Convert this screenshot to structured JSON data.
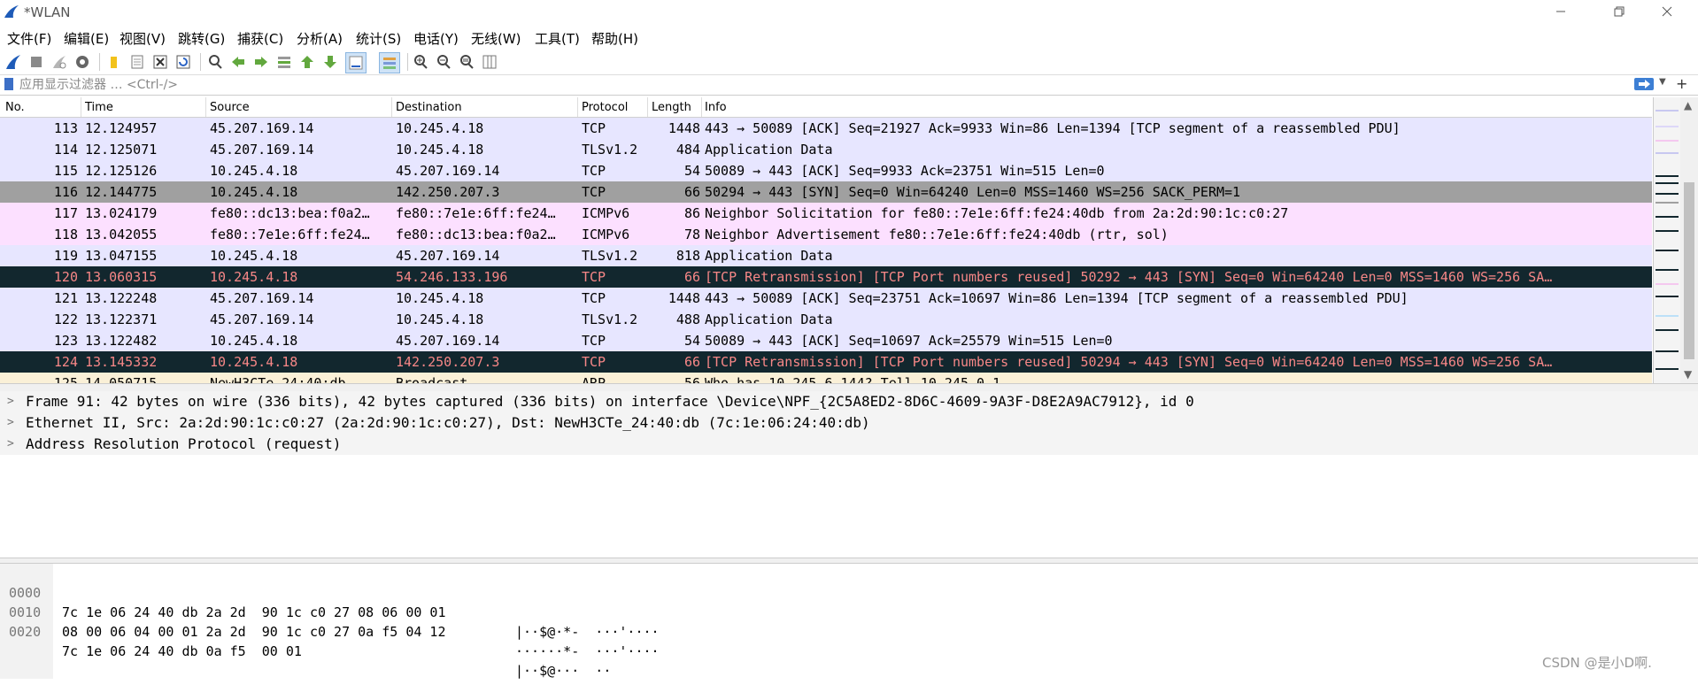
{
  "window": {
    "title": "*WLAN"
  },
  "menu": [
    "文件(F)",
    "编辑(E)",
    "视图(V)",
    "跳转(G)",
    "捕获(C)",
    "分析(A)",
    "统计(S)",
    "电话(Y)",
    "无线(W)",
    "工具(T)",
    "帮助(H)"
  ],
  "filter": {
    "placeholder": "应用显示过滤器 … <Ctrl-/>"
  },
  "columns": [
    "No.",
    "Time",
    "Source",
    "Destination",
    "Protocol",
    "Length",
    "Info"
  ],
  "colors": {
    "tcp_bg": "#e7e6ff",
    "selected_bg": "#a0a0a0",
    "icmp_bg": "#fce0ff",
    "bad_bg": "#12272e",
    "bad_fg": "#f78787",
    "arp_bg": "#faf0d7"
  },
  "packets": [
    {
      "no": "113",
      "time": "12.124957",
      "src": "45.207.169.14",
      "dst": "10.245.4.18",
      "proto": "TCP",
      "len": "1448",
      "info": "443 → 50089 [ACK] Seq=21927 Ack=9933 Win=86 Len=1394 [TCP segment of a reassembled PDU]",
      "style": "tcp"
    },
    {
      "no": "114",
      "time": "12.125071",
      "src": "45.207.169.14",
      "dst": "10.245.4.18",
      "proto": "TLSv1.2",
      "len": "484",
      "info": "Application Data",
      "style": "tcp"
    },
    {
      "no": "115",
      "time": "12.125126",
      "src": "10.245.4.18",
      "dst": "45.207.169.14",
      "proto": "TCP",
      "len": "54",
      "info": "50089 → 443 [ACK] Seq=9933 Ack=23751 Win=515 Len=0",
      "style": "tcp"
    },
    {
      "no": "116",
      "time": "12.144775",
      "src": "10.245.4.18",
      "dst": "142.250.207.3",
      "proto": "TCP",
      "len": "66",
      "info": "50294 → 443 [SYN] Seq=0 Win=64240 Len=0 MSS=1460 WS=256 SACK_PERM=1",
      "style": "selected"
    },
    {
      "no": "117",
      "time": "13.024179",
      "src": "fe80::dc13:bea:f0a2…",
      "dst": "fe80::7e1e:6ff:fe24…",
      "proto": "ICMPv6",
      "len": "86",
      "info": "Neighbor Solicitation for fe80::7e1e:6ff:fe24:40db from 2a:2d:90:1c:c0:27",
      "style": "icmp"
    },
    {
      "no": "118",
      "time": "13.042055",
      "src": "fe80::7e1e:6ff:fe24…",
      "dst": "fe80::dc13:bea:f0a2…",
      "proto": "ICMPv6",
      "len": "78",
      "info": "Neighbor Advertisement fe80::7e1e:6ff:fe24:40db (rtr, sol)",
      "style": "icmp"
    },
    {
      "no": "119",
      "time": "13.047155",
      "src": "10.245.4.18",
      "dst": "45.207.169.14",
      "proto": "TLSv1.2",
      "len": "818",
      "info": "Application Data",
      "style": "tcp"
    },
    {
      "no": "120",
      "time": "13.060315",
      "src": "10.245.4.18",
      "dst": "54.246.133.196",
      "proto": "TCP",
      "len": "66",
      "info": "[TCP Retransmission] [TCP Port numbers reused] 50292 → 443 [SYN] Seq=0 Win=64240 Len=0 MSS=1460 WS=256 SA…",
      "style": "bad"
    },
    {
      "no": "121",
      "time": "13.122248",
      "src": "45.207.169.14",
      "dst": "10.245.4.18",
      "proto": "TCP",
      "len": "1448",
      "info": "443 → 50089 [ACK] Seq=23751 Ack=10697 Win=86 Len=1394 [TCP segment of a reassembled PDU]",
      "style": "tcp"
    },
    {
      "no": "122",
      "time": "13.122371",
      "src": "45.207.169.14",
      "dst": "10.245.4.18",
      "proto": "TLSv1.2",
      "len": "488",
      "info": "Application Data",
      "style": "tcp"
    },
    {
      "no": "123",
      "time": "13.122482",
      "src": "10.245.4.18",
      "dst": "45.207.169.14",
      "proto": "TCP",
      "len": "54",
      "info": "50089 → 443 [ACK] Seq=10697 Ack=25579 Win=515 Len=0",
      "style": "tcp"
    },
    {
      "no": "124",
      "time": "13.145332",
      "src": "10.245.4.18",
      "dst": "142.250.207.3",
      "proto": "TCP",
      "len": "66",
      "info": "[TCP Retransmission] [TCP Port numbers reused] 50294 → 443 [SYN] Seq=0 Win=64240 Len=0 MSS=1460 WS=256 SA…",
      "style": "bad"
    },
    {
      "no": "125",
      "time": "14.050715",
      "src": "NewH3CTe_24:40:db",
      "dst": "Broadcast",
      "proto": "ARP",
      "len": "56",
      "info": "Who has 10.245.6.144? Tell 10.245.0.1",
      "style": "arp"
    }
  ],
  "details": [
    "Frame 91: 42 bytes on wire (336 bits), 42 bytes captured (336 bits) on interface \\Device\\NPF_{2C5A8ED2-8D6C-4609-9A3F-D8E2A9AC7912}, id 0",
    "Ethernet II, Src: 2a:2d:90:1c:c0:27 (2a:2d:90:1c:c0:27), Dst: NewH3CTe_24:40:db (7c:1e:06:24:40:db)",
    "Address Resolution Protocol (request)"
  ],
  "hex": [
    {
      "offset": "0000",
      "bytes": "7c 1e 06 24 40 db 2a 2d  90 1c c0 27 08 06 00 01",
      "ascii": "|··$@·*-  ···'····"
    },
    {
      "offset": "0010",
      "bytes": "08 00 06 04 00 01 2a 2d  90 1c c0 27 0a f5 04 12",
      "ascii": "······*-  ···'····"
    },
    {
      "offset": "0020",
      "bytes": "7c 1e 06 24 40 db 0a f5  00 01",
      "ascii": "|··$@···  ··"
    }
  ],
  "watermark": "CSDN @是小D啊."
}
